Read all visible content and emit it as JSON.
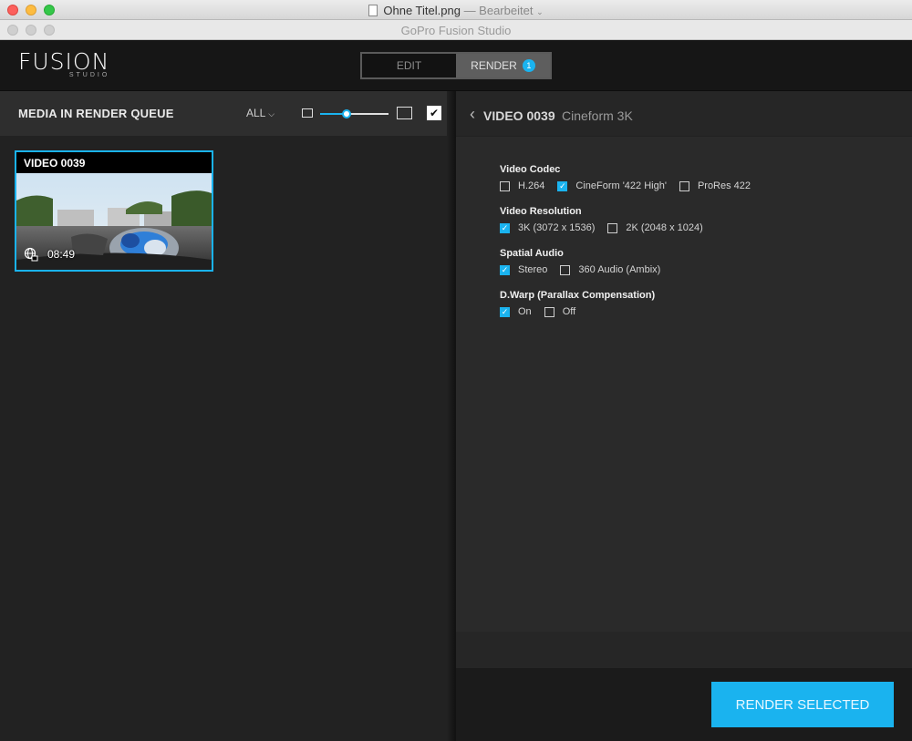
{
  "preview_window": {
    "title": "Ohne Titel.png",
    "subtitle": "— Bearbeitet"
  },
  "app_window": {
    "title": "GoPro Fusion Studio"
  },
  "header": {
    "logo_main": "FUSION",
    "logo_sub": "STUDIO",
    "tabs": [
      {
        "label": "EDIT",
        "active": false
      },
      {
        "label": "RENDER",
        "active": true,
        "badge": "1"
      }
    ]
  },
  "queue": {
    "title": "MEDIA IN RENDER QUEUE",
    "filter_label": "ALL",
    "thumb_size_level": 0.38,
    "select_all_checked": true,
    "items": [
      {
        "title": "VIDEO 0039",
        "duration": "08:49",
        "selected": true,
        "icon": "360-video-icon"
      }
    ]
  },
  "detail": {
    "name": "VIDEO 0039",
    "format": "Cineform 3K",
    "groups": [
      {
        "label": "Video Codec",
        "options": [
          {
            "label": "H.264",
            "checked": false
          },
          {
            "label": "CineForm '422 High'",
            "checked": true
          },
          {
            "label": "ProRes 422",
            "checked": false
          }
        ]
      },
      {
        "label": "Video Resolution",
        "options": [
          {
            "label": "3K (3072 x 1536)",
            "checked": true
          },
          {
            "label": "2K (2048 x 1024)",
            "checked": false
          }
        ]
      },
      {
        "label": "Spatial Audio",
        "options": [
          {
            "label": "Stereo",
            "checked": true
          },
          {
            "label": "360 Audio (Ambix)",
            "checked": false
          }
        ]
      },
      {
        "label": "D.Warp (Parallax Compensation)",
        "options": [
          {
            "label": "On",
            "checked": true
          },
          {
            "label": "Off",
            "checked": false
          }
        ]
      }
    ],
    "render_button": "RENDER SELECTED"
  },
  "colors": {
    "accent": "#1ab3ef",
    "panel_bg": "#222222",
    "header_bg": "#161616"
  }
}
